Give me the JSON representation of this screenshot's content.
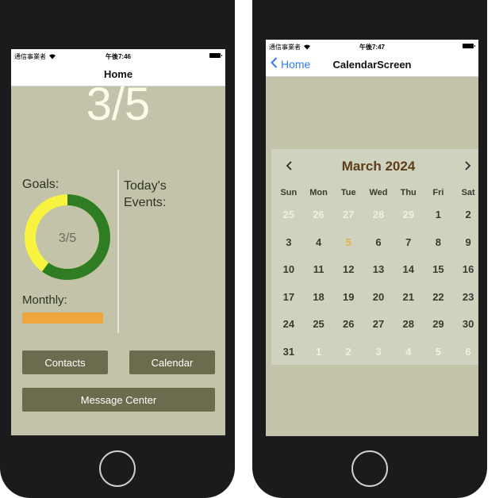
{
  "colors": {
    "screen_bg": "#c2c3a8",
    "score_text": "#fbfbe8",
    "button_bg": "#6a6c4d",
    "donut_done": "#2e7d23",
    "donut_remaining": "#f7f340",
    "monthly_bar": "#f0a63e",
    "nav_back": "#2f7df6",
    "calendar_title": "#5e3d1c",
    "today_highlight": "#e7b045"
  },
  "left": {
    "status": {
      "carrier": "通信事業者",
      "time": "午後7:46"
    },
    "nav": {
      "title": "Home"
    },
    "score": "3/5",
    "goals": {
      "label": "Goals:",
      "center_text": "3/5",
      "completed": 3,
      "total": 5
    },
    "events": {
      "label": "Today's Events:"
    },
    "monthly": {
      "label": "Monthly:",
      "progress": 1.0
    },
    "buttons": {
      "contacts": "Contacts",
      "calendar": "Calendar",
      "message_center": "Message Center"
    }
  },
  "right": {
    "status": {
      "carrier": "通信事業者",
      "time": "午後7:47"
    },
    "nav": {
      "back_label": "Home",
      "title": "CalendarScreen"
    },
    "calendar": {
      "title": "March 2024",
      "prev_icon": "chevron-left-icon",
      "next_icon": "chevron-right-icon",
      "weekdays": [
        "Sun",
        "Mon",
        "Tue",
        "Wed",
        "Thu",
        "Fri",
        "Sat"
      ],
      "today": "5",
      "days": [
        {
          "d": "25",
          "other": true
        },
        {
          "d": "26",
          "other": true
        },
        {
          "d": "27",
          "other": true
        },
        {
          "d": "28",
          "other": true
        },
        {
          "d": "29",
          "other": true
        },
        {
          "d": "1",
          "other": false
        },
        {
          "d": "2",
          "other": false
        },
        {
          "d": "3",
          "other": false
        },
        {
          "d": "4",
          "other": false
        },
        {
          "d": "5",
          "other": false
        },
        {
          "d": "6",
          "other": false
        },
        {
          "d": "7",
          "other": false
        },
        {
          "d": "8",
          "other": false
        },
        {
          "d": "9",
          "other": false
        },
        {
          "d": "10",
          "other": false
        },
        {
          "d": "11",
          "other": false
        },
        {
          "d": "12",
          "other": false
        },
        {
          "d": "13",
          "other": false
        },
        {
          "d": "14",
          "other": false
        },
        {
          "d": "15",
          "other": false
        },
        {
          "d": "16",
          "other": false
        },
        {
          "d": "17",
          "other": false
        },
        {
          "d": "18",
          "other": false
        },
        {
          "d": "19",
          "other": false
        },
        {
          "d": "20",
          "other": false
        },
        {
          "d": "21",
          "other": false
        },
        {
          "d": "22",
          "other": false
        },
        {
          "d": "23",
          "other": false
        },
        {
          "d": "24",
          "other": false
        },
        {
          "d": "25",
          "other": false
        },
        {
          "d": "26",
          "other": false
        },
        {
          "d": "27",
          "other": false
        },
        {
          "d": "28",
          "other": false
        },
        {
          "d": "29",
          "other": false
        },
        {
          "d": "30",
          "other": false
        },
        {
          "d": "31",
          "other": false
        },
        {
          "d": "1",
          "other": true
        },
        {
          "d": "2",
          "other": true
        },
        {
          "d": "3",
          "other": true
        },
        {
          "d": "4",
          "other": true
        },
        {
          "d": "5",
          "other": true
        },
        {
          "d": "6",
          "other": true
        }
      ]
    }
  }
}
